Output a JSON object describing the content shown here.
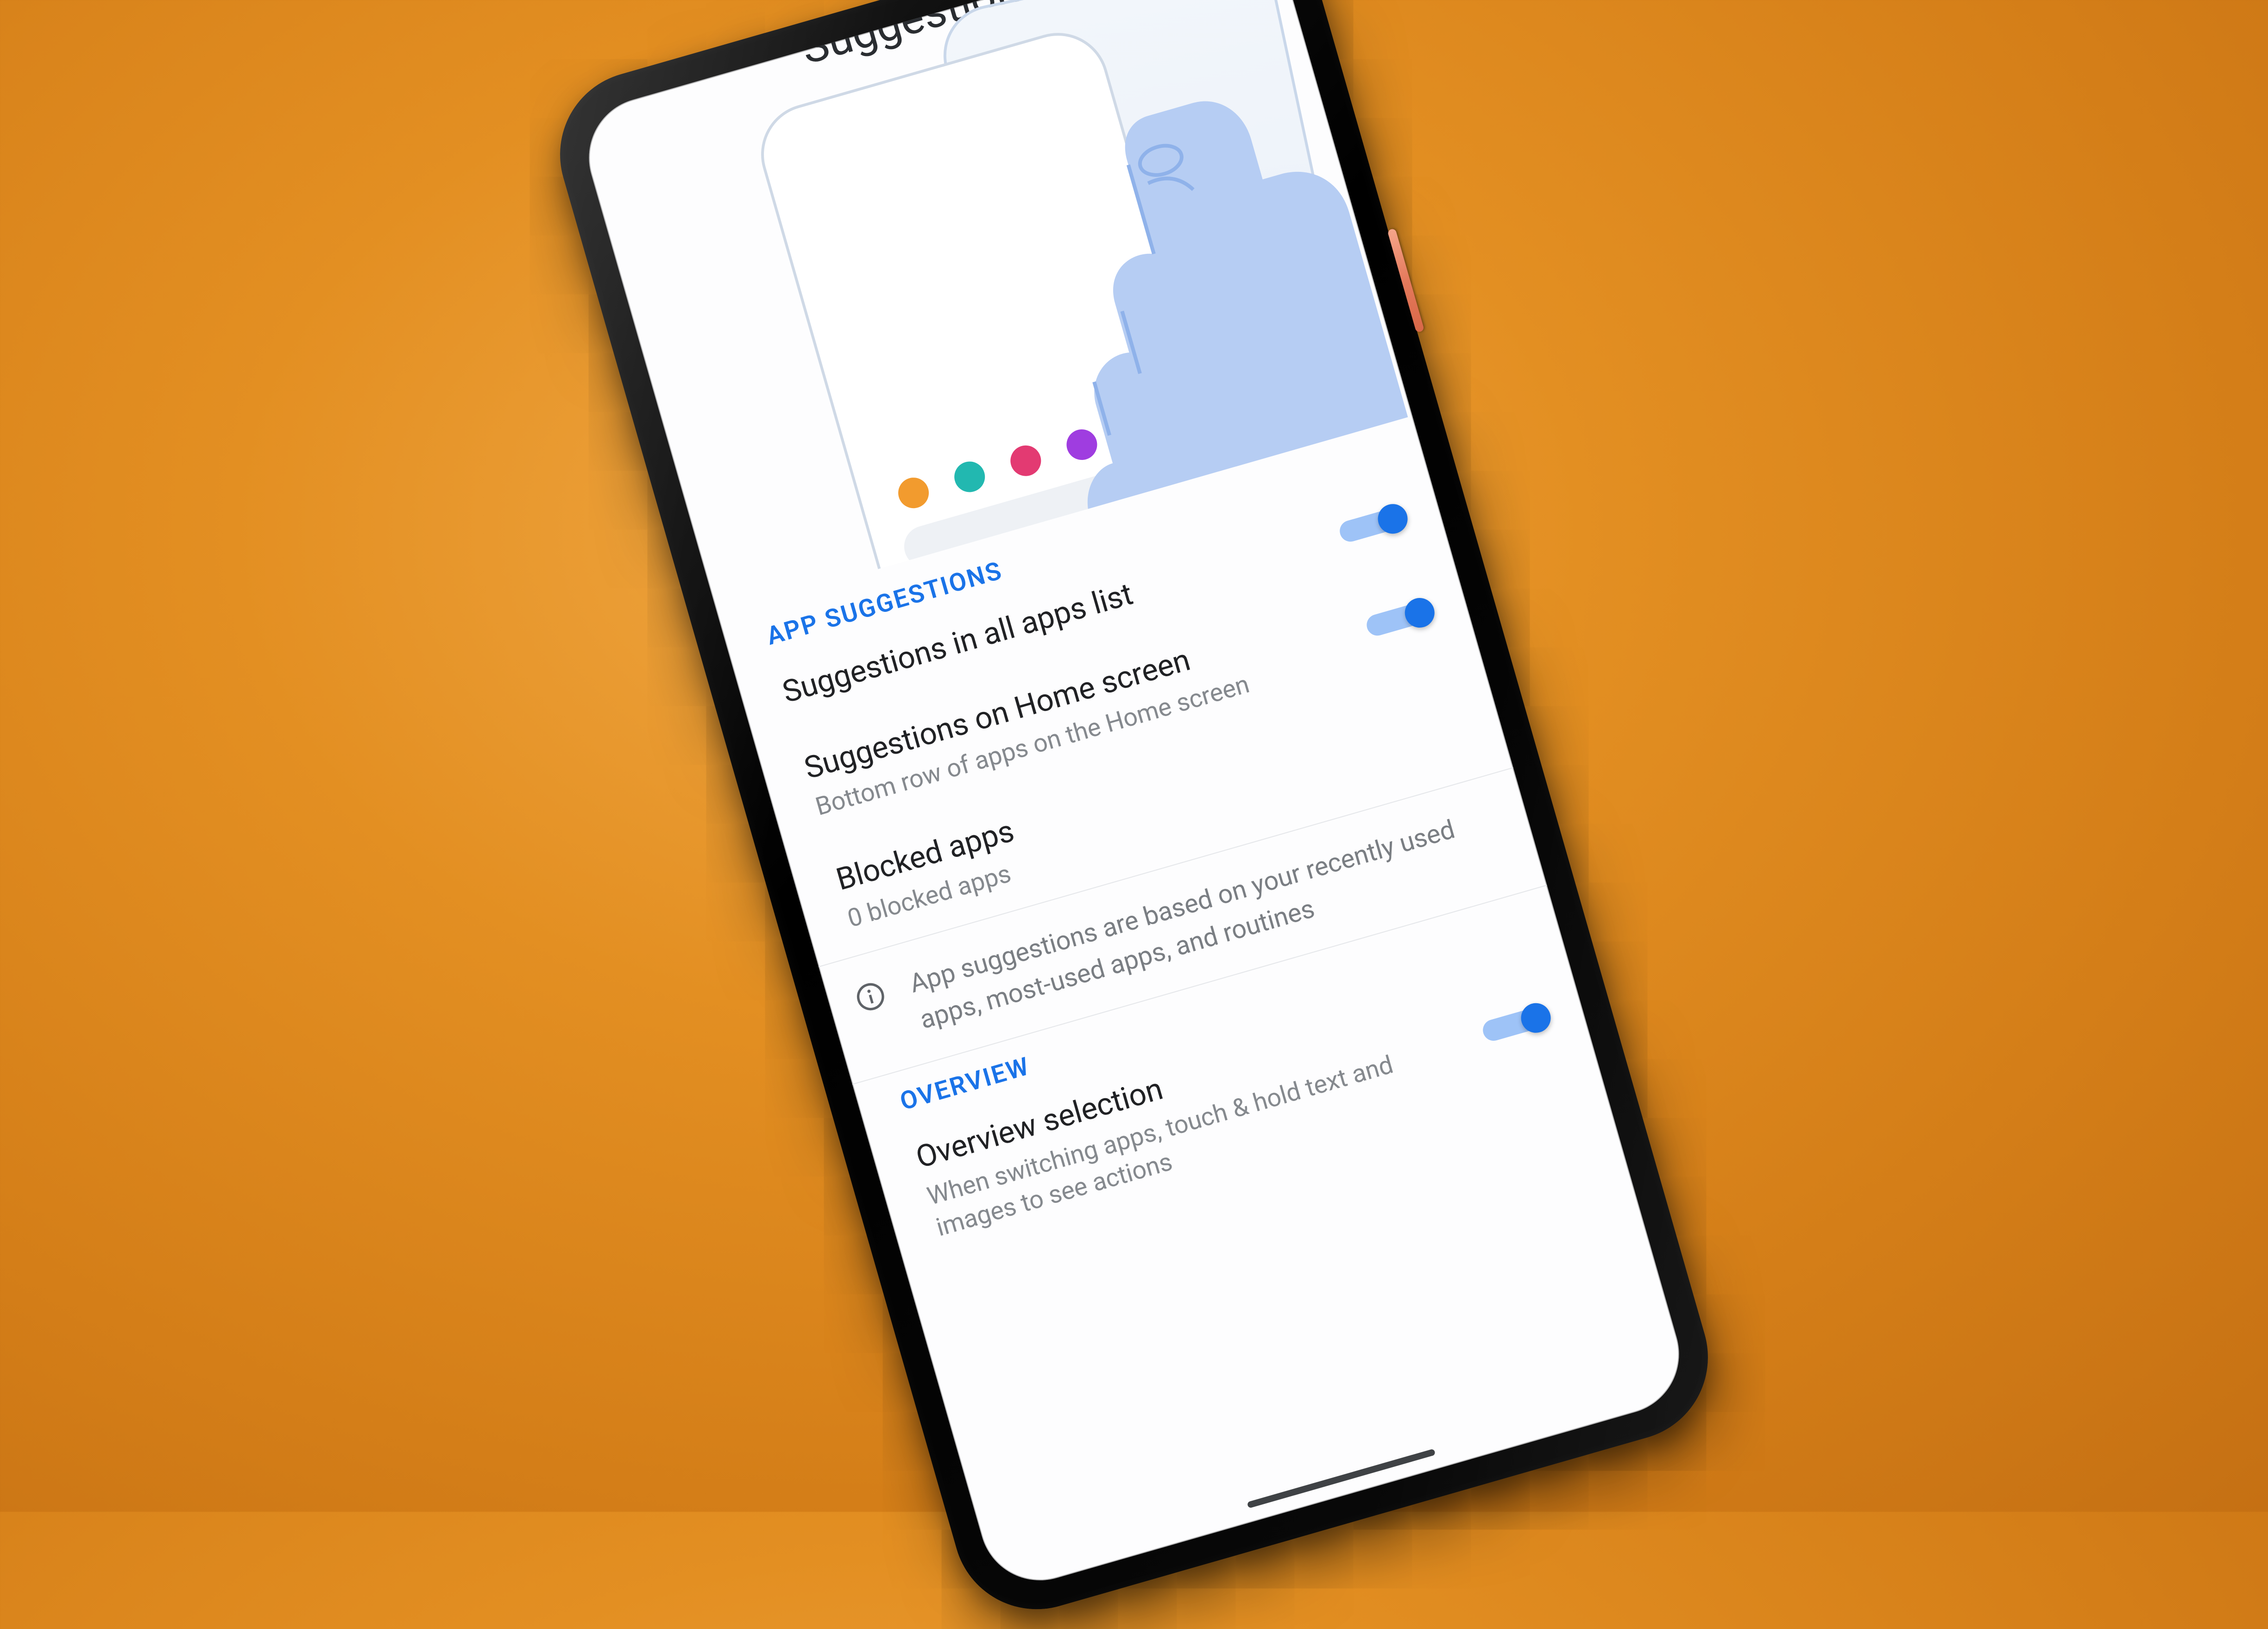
{
  "header": {
    "title": "Suggestions"
  },
  "sections": {
    "app_suggestions": {
      "label": "APP SUGGESTIONS",
      "rows": {
        "all_apps": {
          "title": "Suggestions in all apps list",
          "toggle_on": true
        },
        "home": {
          "title": "Suggestions on Home screen",
          "sub": "Bottom row of apps on the Home screen",
          "toggle_on": true
        },
        "blocked": {
          "title": "Blocked apps",
          "sub": "0 blocked apps"
        }
      },
      "info": "App suggestions are based on your recently used apps, most-used apps, and routines"
    },
    "overview": {
      "label": "OVERVIEW",
      "rows": {
        "selection": {
          "title": "Overview selection",
          "sub": "When switching apps, touch & hold text and images to see actions",
          "toggle_on": true
        }
      }
    }
  },
  "colors": {
    "accent": "#1a73e8",
    "track": "#9ec3f7",
    "text_primary": "#202124",
    "text_secondary": "#85898e",
    "bg": "#e08b1e"
  },
  "hero_dots": [
    "#f29b2e",
    "#22b8b0",
    "#e33a72",
    "#9f3de0"
  ]
}
